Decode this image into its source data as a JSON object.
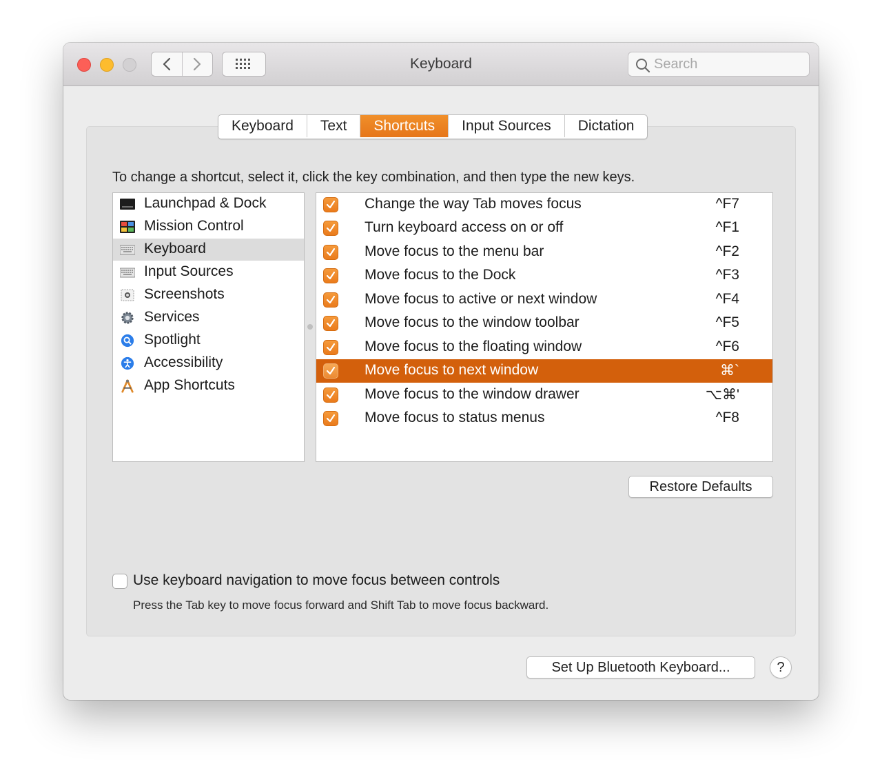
{
  "window": {
    "title": "Keyboard"
  },
  "toolbar": {
    "back_icon": "chevron-left-icon",
    "forward_icon": "chevron-right-icon",
    "grid_icon": "grid-icon"
  },
  "search": {
    "placeholder": "Search",
    "value": ""
  },
  "tabs": [
    {
      "label": "Keyboard"
    },
    {
      "label": "Text"
    },
    {
      "label": "Shortcuts",
      "active": true
    },
    {
      "label": "Input Sources"
    },
    {
      "label": "Dictation"
    }
  ],
  "instructions": "To change a shortcut, select it, click the key combination, and then type the new keys.",
  "categories": [
    {
      "label": "Launchpad & Dock",
      "icon": "launchpad-icon"
    },
    {
      "label": "Mission Control",
      "icon": "mission-control-icon"
    },
    {
      "label": "Keyboard",
      "icon": "keyboard-icon",
      "selected": true
    },
    {
      "label": "Input Sources",
      "icon": "keyboard-icon"
    },
    {
      "label": "Screenshots",
      "icon": "screenshot-icon"
    },
    {
      "label": "Services",
      "icon": "gear-icon"
    },
    {
      "label": "Spotlight",
      "icon": "spotlight-icon"
    },
    {
      "label": "Accessibility",
      "icon": "accessibility-icon"
    },
    {
      "label": "App Shortcuts",
      "icon": "app-shortcuts-icon"
    }
  ],
  "shortcuts": [
    {
      "label": "Change the way Tab moves focus",
      "key": "^F7",
      "checked": true
    },
    {
      "label": "Turn keyboard access on or off",
      "key": "^F1",
      "checked": true
    },
    {
      "label": "Move focus to the menu bar",
      "key": "^F2",
      "checked": true
    },
    {
      "label": "Move focus to the Dock",
      "key": "^F3",
      "checked": true
    },
    {
      "label": "Move focus to active or next window",
      "key": "^F4",
      "checked": true
    },
    {
      "label": "Move focus to the window toolbar",
      "key": "^F5",
      "checked": true
    },
    {
      "label": "Move focus to the floating window",
      "key": "^F6",
      "checked": true
    },
    {
      "label": "Move focus to next window",
      "key": "⌘`",
      "checked": true,
      "selected": true
    },
    {
      "label": "Move focus to the window drawer",
      "key": "⌥⌘'",
      "checked": true
    },
    {
      "label": "Move focus to status menus",
      "key": "^F8",
      "checked": true
    }
  ],
  "restore_defaults": "Restore Defaults",
  "keyboard_navigation": {
    "label": "Use keyboard navigation to move focus between controls",
    "checked": false,
    "help": "Press the Tab key to move focus forward and Shift Tab to move focus backward."
  },
  "bluetooth_button": "Set Up Bluetooth Keyboard...",
  "help_button": "?",
  "colors": {
    "accent": "#e6761a",
    "selection": "#d3600c",
    "close": "#fc5f57",
    "minimize": "#fdbc2e"
  }
}
